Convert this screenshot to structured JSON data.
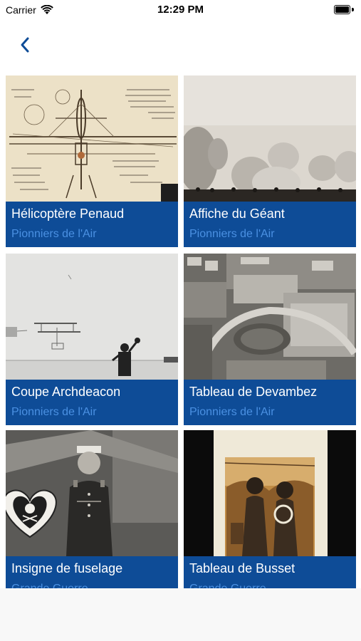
{
  "status_bar": {
    "carrier": "Carrier",
    "time": "12:29 PM"
  },
  "nav": {
    "back_icon": "chevron-left-icon",
    "accent_color": "#0e4c97"
  },
  "colors": {
    "card_background": "#0e4c97",
    "title_text": "#ffffff",
    "subtitle_text": "#4a90e2"
  },
  "items": [
    {
      "title": "Hélicoptère Penaud",
      "subtitle": "Pionniers de l'Air"
    },
    {
      "title": "Affiche du Géant",
      "subtitle": "Pionniers de l'Air"
    },
    {
      "title": "Coupe Archdeacon",
      "subtitle": "Pionniers de l'Air"
    },
    {
      "title": "Tableau de Devambez",
      "subtitle": "Pionniers de l'Air"
    },
    {
      "title": "Insigne de fuselage",
      "subtitle": "Grande Guerre"
    },
    {
      "title": "Tableau de Busset",
      "subtitle": "Grande Guerre"
    }
  ]
}
